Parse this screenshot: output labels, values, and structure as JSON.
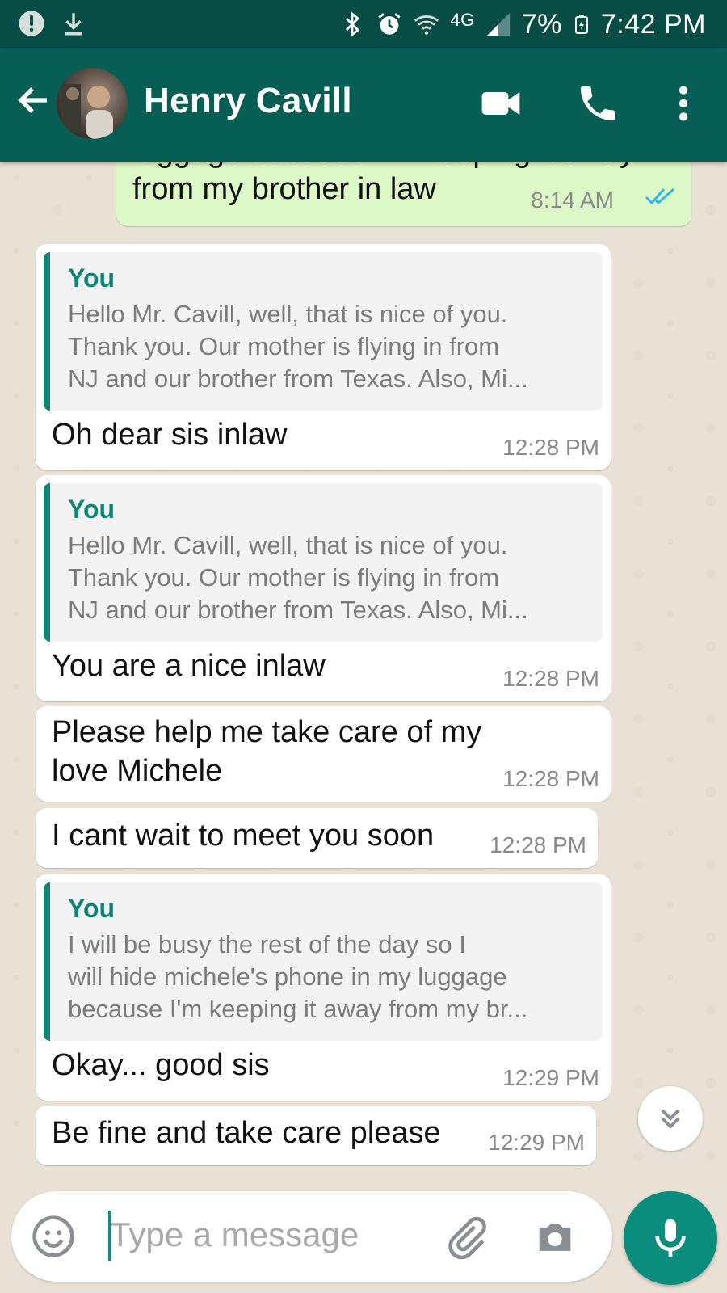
{
  "status_bar": {
    "battery": "7%",
    "time": "7:42 PM",
    "network": "4G"
  },
  "header": {
    "contact_name": "Henry Cavill"
  },
  "messages": [
    {
      "direction": "out",
      "text_lines": [
        "luggage because I'm keeping it away",
        "from my brother in law"
      ],
      "time": "8:14 AM",
      "status": "read"
    },
    {
      "direction": "in",
      "quote": {
        "author": "You",
        "lines": [
          "Hello Mr. Cavill, well, that is nice of you.",
          "Thank you. Our mother is flying in from",
          "NJ and our brother from Texas. Also, Mi..."
        ]
      },
      "text": "Oh dear sis inlaw",
      "time": "12:28 PM"
    },
    {
      "direction": "in",
      "quote": {
        "author": "You",
        "lines": [
          "Hello Mr. Cavill, well, that is nice of you.",
          "Thank you. Our mother is flying in from",
          "NJ and our brother from Texas. Also, Mi..."
        ]
      },
      "text": "You are a nice inlaw",
      "time": "12:28 PM"
    },
    {
      "direction": "in",
      "text_lines": [
        "Please  help me take care of my",
        "love Michele"
      ],
      "time": "12:28 PM"
    },
    {
      "direction": "in",
      "text": "I cant wait to meet you soon",
      "time": "12:28 PM"
    },
    {
      "direction": "in",
      "quote": {
        "author": "You",
        "lines": [
          "I will be busy the rest of the day so I",
          "will hide michele's phone in my luggage",
          "because I'm keeping it away from my br..."
        ]
      },
      "text": "Okay... good sis",
      "time": "12:29 PM"
    },
    {
      "direction": "in",
      "text": "Be fine and take care please",
      "time": "12:29 PM"
    }
  ],
  "composer": {
    "placeholder": "Type a message"
  },
  "colors": {
    "header": "#075e54",
    "statusbar": "#074c45",
    "accent": "#0e8576",
    "outgoing_bubble": "#dcf8c6",
    "read_ticks": "#34b7f1"
  },
  "icons": [
    "alert-icon",
    "download-icon",
    "bluetooth-icon",
    "alarm-icon",
    "wifi-icon",
    "signal-icon",
    "battery-icon",
    "back-arrow-icon",
    "video-call-icon",
    "phone-call-icon",
    "more-options-icon",
    "double-check-icon",
    "chevron-double-down-icon",
    "emoji-icon",
    "attach-icon",
    "camera-icon",
    "mic-icon"
  ]
}
